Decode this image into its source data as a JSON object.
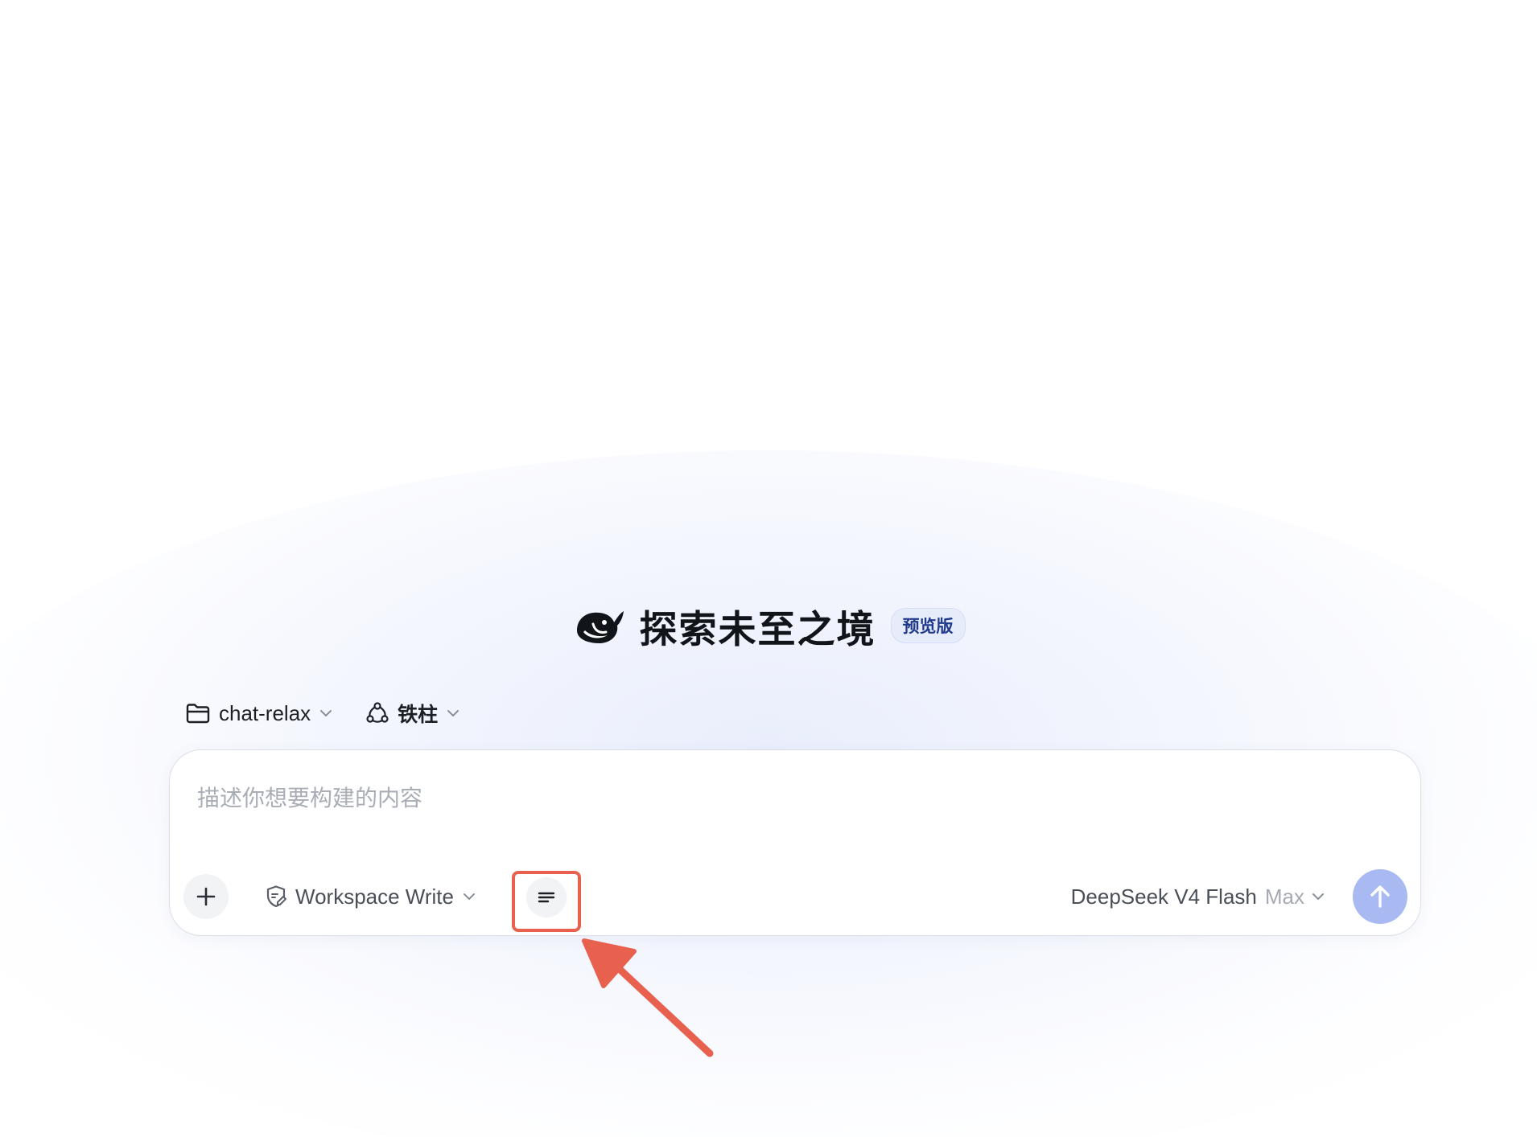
{
  "hero": {
    "title": "探索未至之境",
    "badge": "预览版",
    "logo_icon": "deepseek-whale-icon"
  },
  "selectors": {
    "project": {
      "label": "chat-relax",
      "icon": "folder-icon"
    },
    "agent": {
      "label": "铁柱",
      "icon": "agent-nodes-icon"
    }
  },
  "composer": {
    "placeholder": "描述你想要构建的内容",
    "value": "",
    "add_icon": "plus-icon",
    "mode": {
      "label": "Workspace Write",
      "icon": "shield-edit-icon"
    },
    "menu_icon": "lines-menu-icon",
    "model": {
      "name": "DeepSeek V4 Flash",
      "tier": "Max"
    },
    "send_icon": "arrow-up-icon"
  },
  "annotation": {
    "color": "#e8614f",
    "target": "lines-menu-icon"
  },
  "colors": {
    "accent_badge_bg": "#e7ecfb",
    "accent_badge_text": "#1f3a8a",
    "send_button": "#a9b9f2"
  }
}
